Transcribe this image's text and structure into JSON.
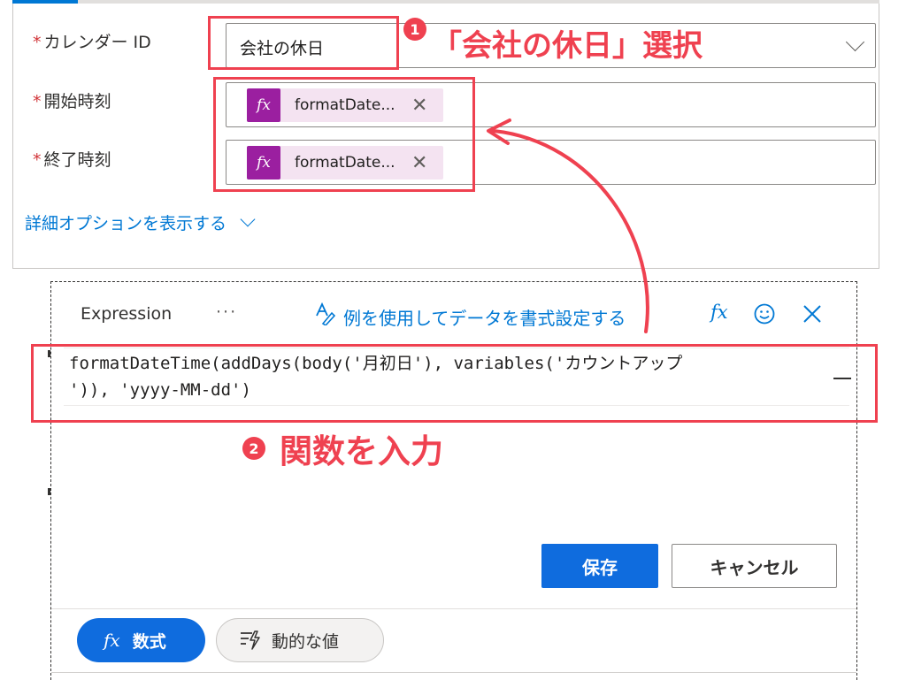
{
  "fields": {
    "calendar_id": {
      "label": "カレンダー ID",
      "required_mark": "*",
      "value": "会社の休日"
    },
    "start_time": {
      "label": "開始時刻",
      "required_mark": "*",
      "token_icon": "fx",
      "token_text": "formatDate...",
      "remove_icon": "✕"
    },
    "end_time": {
      "label": "終了時刻",
      "required_mark": "*",
      "token_icon": "fx",
      "token_text": "formatDate...",
      "remove_icon": "✕"
    }
  },
  "advanced_options_link": "詳細オプションを表示する",
  "annotations": {
    "step1": {
      "badge": "1",
      "text": "「会社の休日」選択"
    },
    "step2": {
      "badge": "2",
      "text": "関数を入力"
    }
  },
  "expression_panel": {
    "title": "Expression",
    "more": "···",
    "format_link": "例を使用してデータを書式設定する",
    "fx_icon": "fx",
    "code_line1": "formatDateTime(addDays(body('月初日'), variables('カウントアップ",
    "code_line2": "')), 'yyyy-MM-dd')",
    "save_label": "保存",
    "cancel_label": "キャンセル",
    "tabs": [
      {
        "icon": "fx",
        "label": "数式",
        "active": true
      },
      {
        "icon": "dynamic-content-icon",
        "label": "動的な値",
        "active": false
      }
    ]
  },
  "colors": {
    "accent": "#0078d4",
    "annotation": "#ef4150",
    "token_icon_bg": "#9b1fa0",
    "token_bg": "#f4e3f1",
    "primary_button": "#0f6cde"
  }
}
